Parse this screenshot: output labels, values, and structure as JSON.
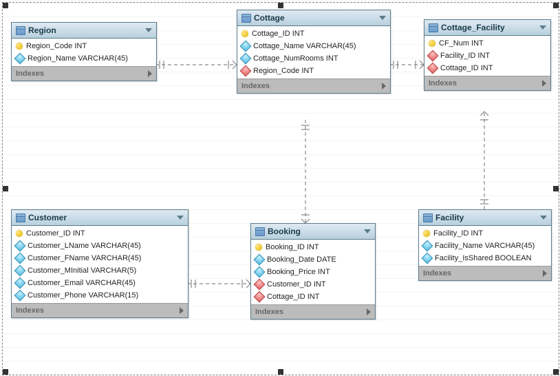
{
  "entities": {
    "region": {
      "title": "Region",
      "cols": [
        {
          "icon": "key",
          "text": "Region_Code INT"
        },
        {
          "icon": "attr",
          "text": "Region_Name VARCHAR(45)"
        }
      ],
      "footer": "Indexes"
    },
    "cottage": {
      "title": "Cottage",
      "cols": [
        {
          "icon": "key",
          "text": "Cottage_ID INT"
        },
        {
          "icon": "attr",
          "text": "Cottage_Name VARCHAR(45)"
        },
        {
          "icon": "attr",
          "text": "Cottage_NumRooms INT"
        },
        {
          "icon": "fk",
          "text": "Region_Code INT"
        }
      ],
      "footer": "Indexes"
    },
    "cottage_facility": {
      "title": "Cottage_Facility",
      "cols": [
        {
          "icon": "key",
          "text": "CF_Num INT"
        },
        {
          "icon": "fk",
          "text": "Facility_ID INT"
        },
        {
          "icon": "fk",
          "text": "Cottage_ID INT"
        }
      ],
      "footer": "Indexes"
    },
    "customer": {
      "title": "Customer",
      "cols": [
        {
          "icon": "key",
          "text": "Customer_ID INT"
        },
        {
          "icon": "attr",
          "text": "Customer_LName VARCHAR(45)"
        },
        {
          "icon": "attr",
          "text": "Customer_FName VARCHAR(45)"
        },
        {
          "icon": "attr",
          "text": "Customer_MInitial VARCHAR(5)"
        },
        {
          "icon": "attr",
          "text": "Customer_Email VARCHAR(45)"
        },
        {
          "icon": "attr",
          "text": "Customer_Phone VARCHAR(15)"
        }
      ],
      "footer": "Indexes"
    },
    "booking": {
      "title": "Booking",
      "cols": [
        {
          "icon": "key",
          "text": "Booking_ID INT"
        },
        {
          "icon": "attr",
          "text": "Booking_Date DATE"
        },
        {
          "icon": "attr",
          "text": "Booking_Price INT"
        },
        {
          "icon": "fk",
          "text": "Customer_ID INT"
        },
        {
          "icon": "fk",
          "text": "Cottage_ID INT"
        }
      ],
      "footer": "Indexes"
    },
    "facility": {
      "title": "Facility",
      "cols": [
        {
          "icon": "key",
          "text": "Facility_ID INT"
        },
        {
          "icon": "attr",
          "text": "Facility_Name VARCHAR(45)"
        },
        {
          "icon": "attr",
          "text": "Facility_IsShared BOOLEAN"
        }
      ],
      "footer": "Indexes"
    }
  }
}
